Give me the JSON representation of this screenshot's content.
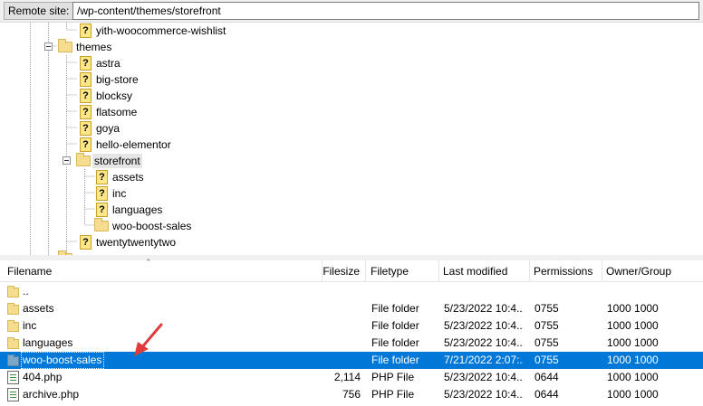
{
  "sitebar": {
    "label": "Remote site:",
    "path": "/wp-content/themes/storefront"
  },
  "tree": {
    "nodes": [
      {
        "label": "yith-woocommerce-wishlist",
        "icon": "unknown-folder-icon"
      },
      {
        "label": "themes",
        "icon": "folder-icon"
      },
      {
        "label": "astra",
        "icon": "unknown-folder-icon"
      },
      {
        "label": "big-store",
        "icon": "unknown-folder-icon"
      },
      {
        "label": "blocksy",
        "icon": "unknown-folder-icon"
      },
      {
        "label": "flatsome",
        "icon": "unknown-folder-icon"
      },
      {
        "label": "goya",
        "icon": "unknown-folder-icon"
      },
      {
        "label": "hello-elementor",
        "icon": "unknown-folder-icon"
      },
      {
        "label": "storefront",
        "icon": "folder-icon"
      },
      {
        "label": "assets",
        "icon": "unknown-folder-icon"
      },
      {
        "label": "inc",
        "icon": "unknown-folder-icon"
      },
      {
        "label": "languages",
        "icon": "unknown-folder-icon"
      },
      {
        "label": "woo-boost-sales",
        "icon": "folder-icon"
      },
      {
        "label": "twentytwentytwo",
        "icon": "unknown-folder-icon"
      }
    ]
  },
  "filelist": {
    "columns": {
      "filename": "Filename",
      "filesize": "Filesize",
      "filetype": "Filetype",
      "modified": "Last modified",
      "permissions": "Permissions",
      "owner": "Owner/Group"
    },
    "rows": [
      {
        "name": "..",
        "size": "",
        "type": "",
        "modified": "",
        "perms": "",
        "owner": "",
        "icon": "folder-icon"
      },
      {
        "name": "assets",
        "size": "",
        "type": "File folder",
        "modified": "5/23/2022 10:4...",
        "perms": "0755",
        "owner": "1000 1000",
        "icon": "folder-icon"
      },
      {
        "name": "inc",
        "size": "",
        "type": "File folder",
        "modified": "5/23/2022 10:4...",
        "perms": "0755",
        "owner": "1000 1000",
        "icon": "folder-icon"
      },
      {
        "name": "languages",
        "size": "",
        "type": "File folder",
        "modified": "5/23/2022 10:4...",
        "perms": "0755",
        "owner": "1000 1000",
        "icon": "folder-icon"
      },
      {
        "name": "woo-boost-sales",
        "size": "",
        "type": "File folder",
        "modified": "7/21/2022 2:07:...",
        "perms": "0755",
        "owner": "1000 1000",
        "icon": "folder-icon"
      },
      {
        "name": "404.php",
        "size": "2,114",
        "type": "PHP File",
        "modified": "5/23/2022 10:4...",
        "perms": "0644",
        "owner": "1000 1000",
        "icon": "php-file-icon"
      },
      {
        "name": "archive.php",
        "size": "756",
        "type": "PHP File",
        "modified": "5/23/2022 10:4...",
        "perms": "0644",
        "owner": "1000 1000",
        "icon": "php-file-icon"
      }
    ]
  },
  "colors": {
    "selection": "#0078d7",
    "annotation_arrow": "#e03c3c"
  }
}
